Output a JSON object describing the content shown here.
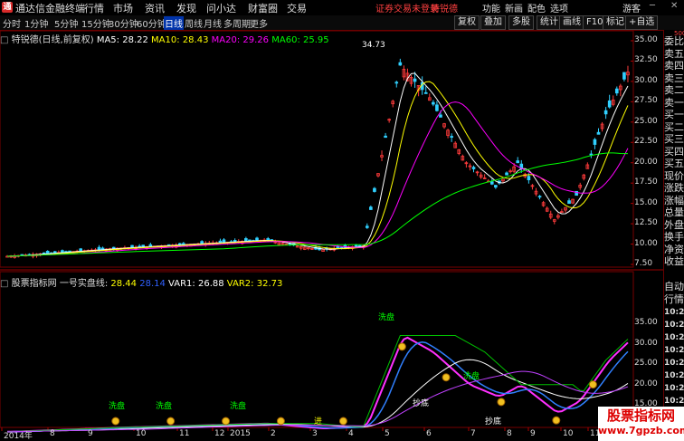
{
  "app": {
    "title": "通达信金融终端",
    "menu": [
      "行情",
      "市场",
      "资讯",
      "发现",
      "问小达",
      "财富圈",
      "交易"
    ],
    "alert": "证券交易未登录",
    "stock_name": "特锐德",
    "right": [
      "功能",
      "新画",
      "配色",
      "选项"
    ],
    "guest": "游客"
  },
  "toolbar": {
    "timeframes": [
      "分时",
      "1分钟",
      "5分钟",
      "15分钟",
      "30分钟",
      "60分钟",
      "日线",
      "周线",
      "月线",
      "多周期",
      "更多"
    ],
    "active": "日线",
    "buttons": [
      "复权",
      "叠加",
      "多股",
      "统计",
      "画线",
      "F10",
      "标记",
      "+自选"
    ]
  },
  "main_chart": {
    "label": "特锐德(日线,前复权)",
    "ma": [
      {
        "name": "MA5",
        "value": "28.22",
        "color": "#ffffff"
      },
      {
        "name": "MA10",
        "value": "28.43",
        "color": "#ffff00"
      },
      {
        "name": "MA20",
        "value": "29.26",
        "color": "#ff00ff"
      },
      {
        "name": "MA60",
        "value": "25.95",
        "color": "#00ff00"
      }
    ],
    "peak_label": "34.73",
    "price_axis": [
      "35.00",
      "32.50",
      "30.00",
      "27.50",
      "25.00",
      "22.50",
      "20.00",
      "17.50",
      "15.00",
      "12.50",
      "10.00",
      "7.50"
    ]
  },
  "sub_chart": {
    "label": "股票指标网",
    "indicator": "一号实盘线",
    "values": [
      {
        "name": "",
        "value": "28.44",
        "color": "#ffff00"
      },
      {
        "name": "VAR1",
        "value": "26.88",
        "color": "#ffffff"
      },
      {
        "name": "VAR2",
        "value": "32.73",
        "color": "#ffff00"
      }
    ],
    "price_axis": [
      "35.00",
      "30.00",
      "25.00",
      "20.00",
      "15.00",
      "10.00"
    ],
    "annotations": [
      "洗盘",
      "抄底",
      "进"
    ]
  },
  "x_axis": [
    "2014年",
    "8",
    "9",
    "10",
    "11",
    "12",
    "2015",
    "2",
    "3",
    "4",
    "5",
    "6",
    "7",
    "8",
    "9",
    "10",
    "11"
  ],
  "side_panel": {
    "top": [
      "委比",
      "卖五",
      "卖四",
      "卖三",
      "卖二",
      "卖一",
      "买一",
      "买二",
      "买三",
      "买四",
      "买五",
      "现价",
      "涨跌",
      "涨幅",
      "总量",
      "外盘",
      "换手",
      "净资",
      "收益"
    ],
    "bottom_header": [
      "自动",
      "行情"
    ],
    "times": [
      "10:26",
      "10:26",
      "10:26",
      "10:26",
      "10:26",
      "10:26",
      "10:26",
      "10:26",
      "10:26"
    ],
    "mini_label": "500"
  },
  "watermark": {
    "title": "股票指标网",
    "url": "www.7gpzb.com"
  }
}
